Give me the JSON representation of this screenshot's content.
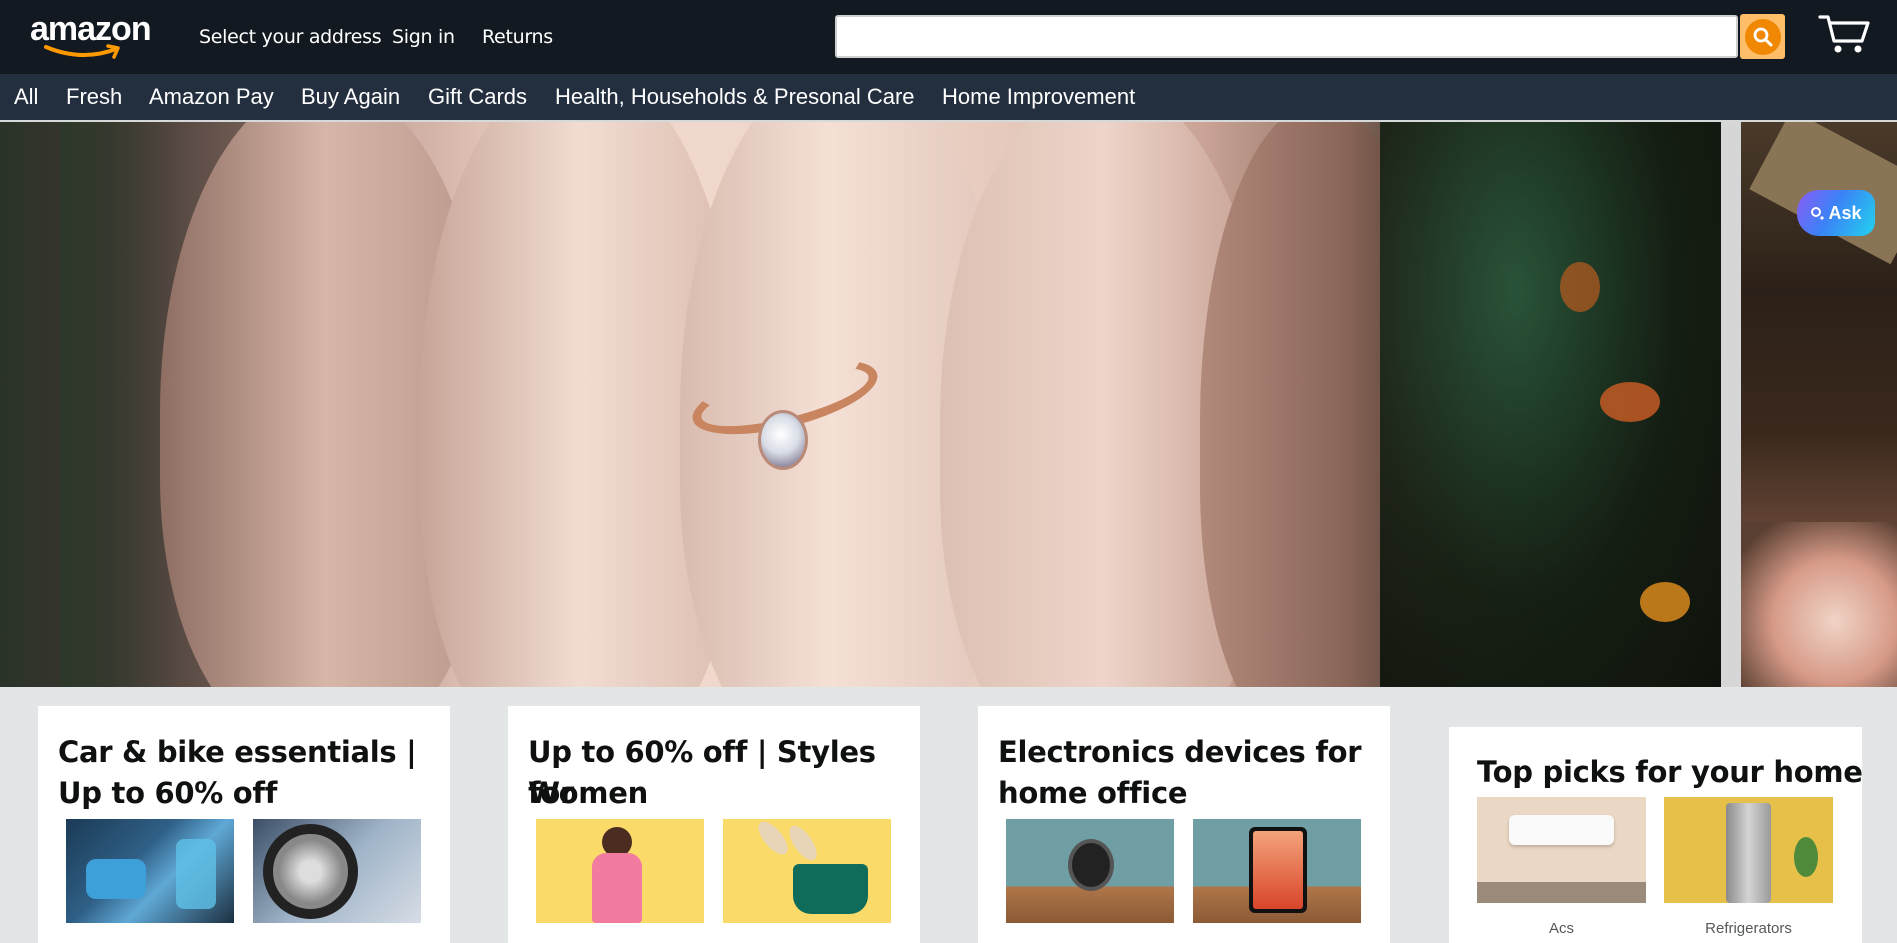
{
  "header": {
    "logo_text": "amazon",
    "address_label": "Select your address",
    "signin_label": "Sign in",
    "returns_label": "Returns",
    "search_value": "",
    "search_placeholder": "",
    "search_icon": "search-icon",
    "cart_icon": "cart-icon"
  },
  "subnav": {
    "items": [
      "All",
      "Fresh",
      "Amazon Pay",
      "Buy Again",
      "Gift Cards",
      "Health, Households & Presonal Care",
      "Home Improvement"
    ]
  },
  "assistant": {
    "label": "Ask"
  },
  "cards": [
    {
      "title_line1": "Car & bike essentials |",
      "title_line2": "Up to 60% off"
    },
    {
      "title_line1": "Up to 60% off | Styles for",
      "title_line2": "Women"
    },
    {
      "title_line1": "Electronics devices for",
      "title_line2": "home office"
    },
    {
      "title": "Top picks for your home",
      "tiles": [
        "Acs",
        "Refrigerators"
      ]
    }
  ],
  "colors": {
    "header_bg": "#131921",
    "subnav_bg": "#232f3e",
    "search_button": "#febd69",
    "logo_smile": "#ff9900"
  }
}
